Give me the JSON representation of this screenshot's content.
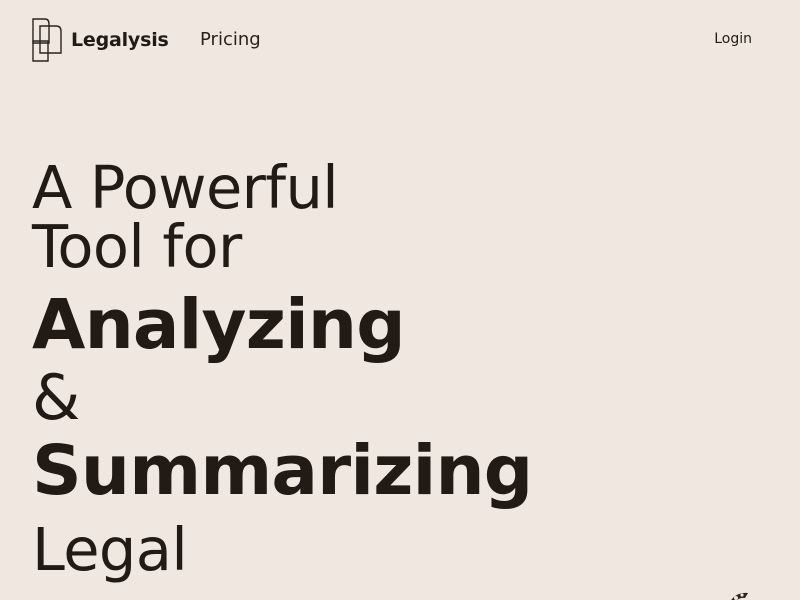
{
  "header": {
    "brand": "Legalysis",
    "nav_pricing": "Pricing",
    "login": "Login"
  },
  "hero": {
    "line1": "A Powerful",
    "line2": "Tool for",
    "line3": "Analyzing",
    "line4": "&",
    "line5": "Summarizing",
    "line6": "Legal"
  },
  "icons": {
    "logo": "legalysis-logo-icon",
    "decor": "decorative-mark-icon"
  },
  "colors": {
    "background": "#f0e7e0",
    "text": "#221b15"
  }
}
